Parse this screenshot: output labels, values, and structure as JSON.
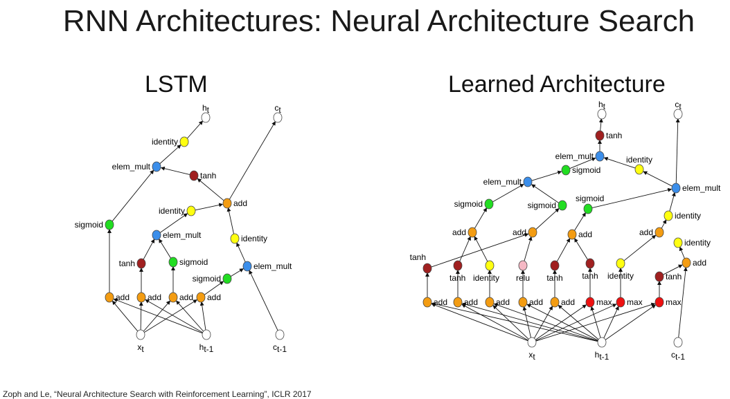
{
  "title": "RNN Architectures: Neural Architecture Search",
  "citation": "Zoph and Le, “Neural Architecture Search with Reinforcement Learning”, ICLR 2017",
  "colors": {
    "add": "#f39c12",
    "sigmoid": "#22dd22",
    "elem_mult": "#3b8eea",
    "identity": "#ffff11",
    "tanh": "#a02020",
    "max": "#ee1111",
    "relu": "#f5b8c4",
    "io": "#ffffff"
  },
  "lstm": {
    "title": "LSTM",
    "nodes": [
      {
        "id": "xt",
        "op": "io",
        "label": "x",
        "sub": "t"
      },
      {
        "id": "ht1",
        "op": "io",
        "label": "h",
        "sub": "t-1"
      },
      {
        "id": "ct1",
        "op": "io",
        "label": "c",
        "sub": "t-1"
      },
      {
        "id": "ht",
        "op": "io",
        "label": "h",
        "sub": "t"
      },
      {
        "id": "ct",
        "op": "io",
        "label": "c",
        "sub": "t"
      },
      {
        "id": "a1",
        "op": "add",
        "label": "add"
      },
      {
        "id": "a2",
        "op": "add",
        "label": "add"
      },
      {
        "id": "a3",
        "op": "add",
        "label": "add"
      },
      {
        "id": "a4",
        "op": "add",
        "label": "add"
      },
      {
        "id": "sig1",
        "op": "sigmoid",
        "label": "sigmoid"
      },
      {
        "id": "tanh1",
        "op": "tanh",
        "label": "tanh"
      },
      {
        "id": "sig2",
        "op": "sigmoid",
        "label": "sigmoid"
      },
      {
        "id": "sig3",
        "op": "sigmoid",
        "label": "sigmoid"
      },
      {
        "id": "em1",
        "op": "elem_mult",
        "label": "elem_mult"
      },
      {
        "id": "em2",
        "op": "elem_mult",
        "label": "elem_mult"
      },
      {
        "id": "id1",
        "op": "identity",
        "label": "identity"
      },
      {
        "id": "id2",
        "op": "identity",
        "label": "identity"
      },
      {
        "id": "addc",
        "op": "add",
        "label": "add"
      },
      {
        "id": "tanh2",
        "op": "tanh",
        "label": "tanh"
      },
      {
        "id": "em3",
        "op": "elem_mult",
        "label": "elem_mult"
      },
      {
        "id": "id3",
        "op": "identity",
        "label": "identity"
      }
    ],
    "edges": [
      [
        "xt",
        "a1"
      ],
      [
        "xt",
        "a2"
      ],
      [
        "xt",
        "a3"
      ],
      [
        "xt",
        "a4"
      ],
      [
        "ht1",
        "a1"
      ],
      [
        "ht1",
        "a2"
      ],
      [
        "ht1",
        "a3"
      ],
      [
        "ht1",
        "a4"
      ],
      [
        "a1",
        "sig1"
      ],
      [
        "a2",
        "tanh1"
      ],
      [
        "a3",
        "sig2"
      ],
      [
        "a4",
        "sig3"
      ],
      [
        "tanh1",
        "em1"
      ],
      [
        "sig2",
        "em1"
      ],
      [
        "sig3",
        "em2"
      ],
      [
        "ct1",
        "em2"
      ],
      [
        "em1",
        "id1"
      ],
      [
        "em2",
        "id2"
      ],
      [
        "id1",
        "addc"
      ],
      [
        "id2",
        "addc"
      ],
      [
        "addc",
        "tanh2"
      ],
      [
        "addc",
        "ct"
      ],
      [
        "tanh2",
        "em3"
      ],
      [
        "sig1",
        "em3"
      ],
      [
        "em3",
        "id3"
      ],
      [
        "id3",
        "ht"
      ]
    ]
  },
  "learned": {
    "title": "Learned Architecture",
    "nodes": [
      {
        "id": "xt",
        "op": "io",
        "label": "x",
        "sub": "t"
      },
      {
        "id": "ht1",
        "op": "io",
        "label": "h",
        "sub": "t-1"
      },
      {
        "id": "ct1",
        "op": "io",
        "label": "c",
        "sub": "t-1"
      },
      {
        "id": "ht",
        "op": "io",
        "label": "h",
        "sub": "t"
      },
      {
        "id": "ct",
        "op": "io",
        "label": "c",
        "sub": "t"
      },
      {
        "id": "b1",
        "op": "add",
        "label": "add"
      },
      {
        "id": "b2",
        "op": "add",
        "label": "add"
      },
      {
        "id": "b3",
        "op": "add",
        "label": "add"
      },
      {
        "id": "b4",
        "op": "add",
        "label": "add"
      },
      {
        "id": "b5",
        "op": "add",
        "label": "add"
      },
      {
        "id": "b6",
        "op": "max",
        "label": "max"
      },
      {
        "id": "b7",
        "op": "max",
        "label": "max"
      },
      {
        "id": "b8",
        "op": "max",
        "label": "max"
      },
      {
        "id": "m1",
        "op": "tanh",
        "label": "tanh"
      },
      {
        "id": "m2",
        "op": "tanh",
        "label": "tanh"
      },
      {
        "id": "m3",
        "op": "identity",
        "label": "identity"
      },
      {
        "id": "m4",
        "op": "relu",
        "label": "relu"
      },
      {
        "id": "m5",
        "op": "tanh",
        "label": "tanh"
      },
      {
        "id": "m6",
        "op": "tanh",
        "label": "tanh"
      },
      {
        "id": "m7",
        "op": "identity",
        "label": "identity"
      },
      {
        "id": "m8",
        "op": "tanh",
        "label": "tanh"
      },
      {
        "id": "r1",
        "op": "add",
        "label": "add"
      },
      {
        "id": "r2",
        "op": "add",
        "label": "add"
      },
      {
        "id": "r3",
        "op": "add",
        "label": "add"
      },
      {
        "id": "r4",
        "op": "add",
        "label": "add"
      },
      {
        "id": "r5",
        "op": "add",
        "label": "add"
      },
      {
        "id": "id5",
        "op": "identity",
        "label": "identity"
      },
      {
        "id": "id6",
        "op": "identity",
        "label": "identity"
      },
      {
        "id": "sg1",
        "op": "sigmoid",
        "label": "sigmoid"
      },
      {
        "id": "sg2",
        "op": "sigmoid",
        "label": "sigmoid"
      },
      {
        "id": "sg3",
        "op": "sigmoid",
        "label": "sigmoid"
      },
      {
        "id": "em1",
        "op": "elem_mult",
        "label": "elem_mult"
      },
      {
        "id": "em2",
        "op": "elem_mult",
        "label": "elem_mult"
      },
      {
        "id": "sg4",
        "op": "sigmoid",
        "label": "sigmoid"
      },
      {
        "id": "id7",
        "op": "identity",
        "label": "identity"
      },
      {
        "id": "em3",
        "op": "elem_mult",
        "label": "elem_mult"
      },
      {
        "id": "th",
        "op": "tanh",
        "label": "tanh"
      }
    ],
    "edges": [
      [
        "xt",
        "b1"
      ],
      [
        "xt",
        "b2"
      ],
      [
        "xt",
        "b3"
      ],
      [
        "xt",
        "b4"
      ],
      [
        "xt",
        "b5"
      ],
      [
        "xt",
        "b6"
      ],
      [
        "xt",
        "b7"
      ],
      [
        "xt",
        "b8"
      ],
      [
        "ht1",
        "b1"
      ],
      [
        "ht1",
        "b2"
      ],
      [
        "ht1",
        "b3"
      ],
      [
        "ht1",
        "b4"
      ],
      [
        "ht1",
        "b5"
      ],
      [
        "ht1",
        "b6"
      ],
      [
        "ht1",
        "b7"
      ],
      [
        "ht1",
        "b8"
      ],
      [
        "b1",
        "m1"
      ],
      [
        "b2",
        "m2"
      ],
      [
        "b3",
        "m3"
      ],
      [
        "b4",
        "m4"
      ],
      [
        "b5",
        "m5"
      ],
      [
        "b6",
        "m6"
      ],
      [
        "b7",
        "m7"
      ],
      [
        "b8",
        "m8"
      ],
      [
        "m1",
        "r2"
      ],
      [
        "m2",
        "r1"
      ],
      [
        "m3",
        "r1"
      ],
      [
        "m4",
        "r2"
      ],
      [
        "m5",
        "r3"
      ],
      [
        "m6",
        "r3"
      ],
      [
        "m7",
        "r4"
      ],
      [
        "m8",
        "r5"
      ],
      [
        "ct1",
        "r5"
      ],
      [
        "r5",
        "id5"
      ],
      [
        "r4",
        "id6"
      ],
      [
        "r1",
        "sg1"
      ],
      [
        "r2",
        "sg2"
      ],
      [
        "r3",
        "sg3"
      ],
      [
        "sg1",
        "em1"
      ],
      [
        "sg2",
        "em1"
      ],
      [
        "id6",
        "em2"
      ],
      [
        "sg3",
        "em2"
      ],
      [
        "em1",
        "sg4"
      ],
      [
        "em2",
        "id7"
      ],
      [
        "em2",
        "ct"
      ],
      [
        "sg4",
        "em3"
      ],
      [
        "id7",
        "em3"
      ],
      [
        "em3",
        "th"
      ],
      [
        "th",
        "ht"
      ]
    ]
  }
}
